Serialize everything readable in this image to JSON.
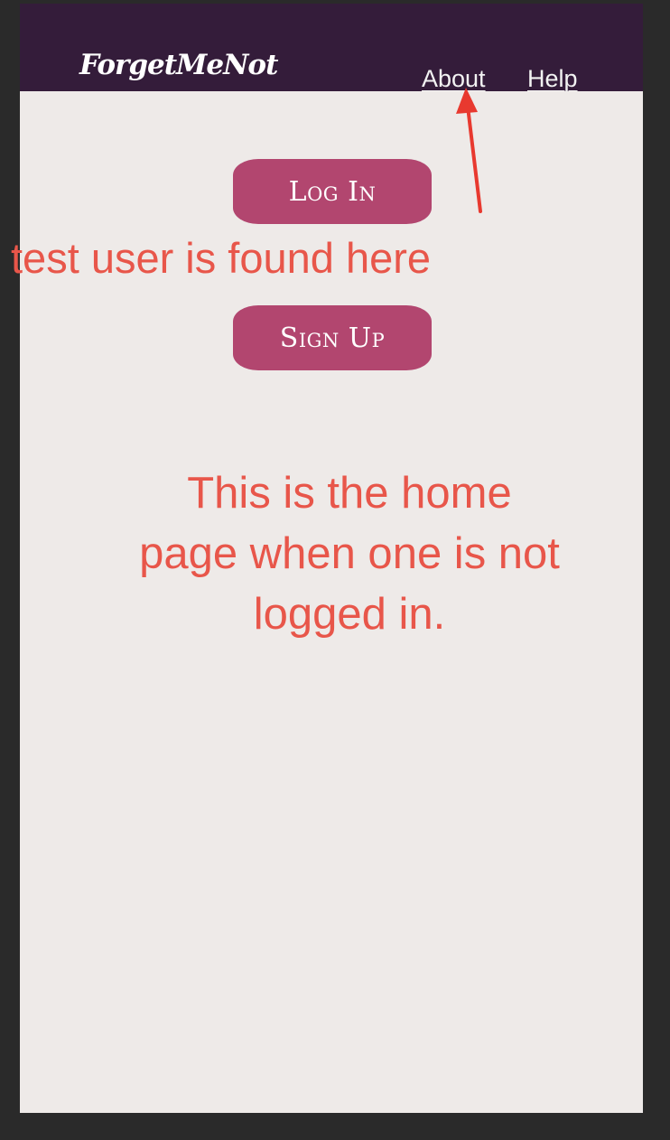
{
  "app": {
    "brand": "ForgetMeNot"
  },
  "nav": {
    "items": [
      {
        "label": "About"
      },
      {
        "label": "Help"
      }
    ]
  },
  "main": {
    "login_label": "Log In",
    "signup_label": "Sign Up"
  },
  "annotations": {
    "test_user_note": "test user is found here",
    "home_note": "This is the home page when one is not logged in."
  },
  "colors": {
    "background": "#2a2a2a",
    "header": "#341c3a",
    "page": "#eeeae8",
    "button": "#b2466f",
    "annotation": "#e8564a"
  },
  "icons": {
    "annotation_arrow": "arrow-up-icon"
  }
}
